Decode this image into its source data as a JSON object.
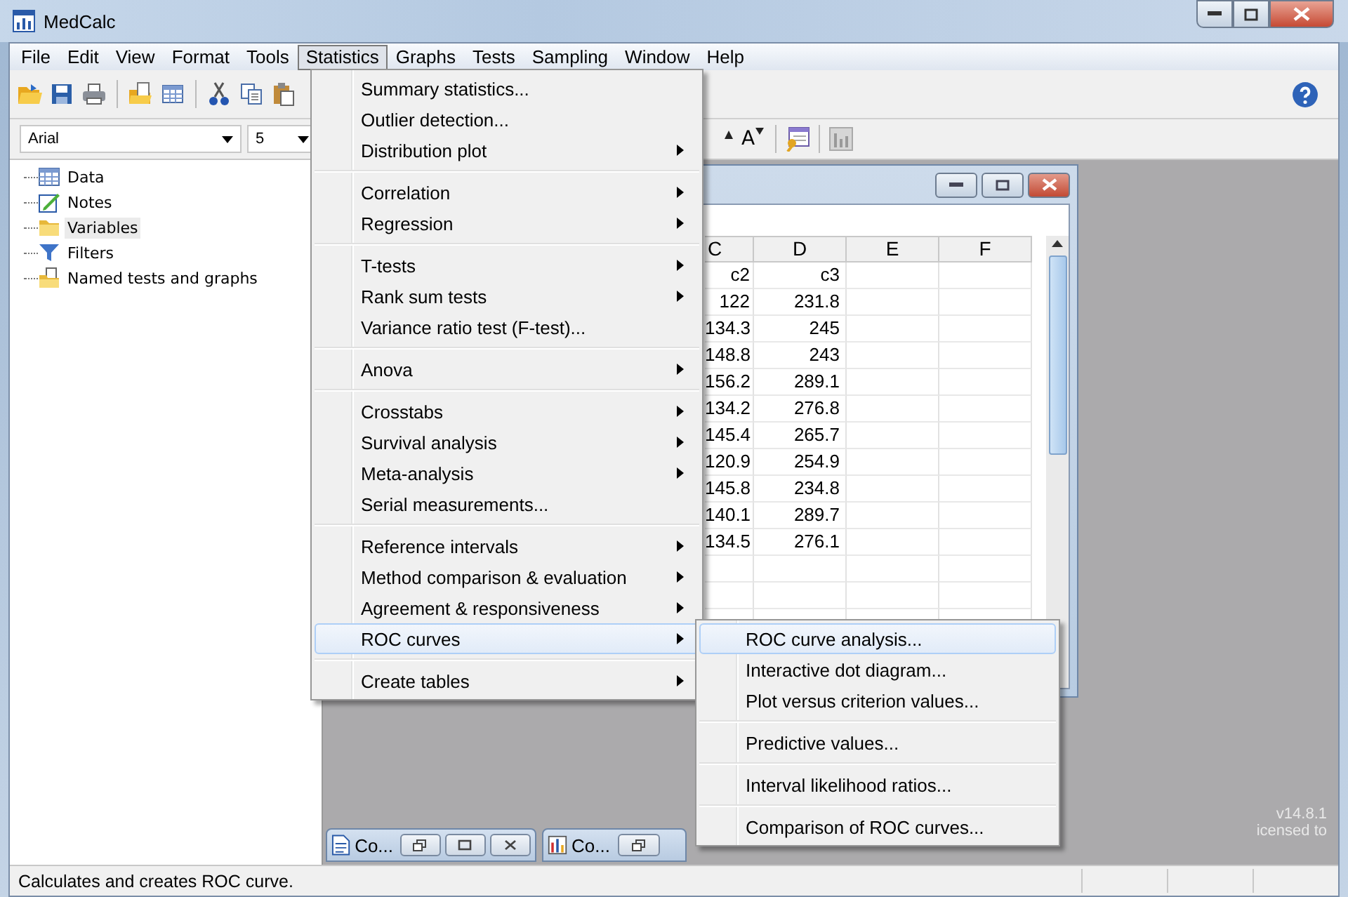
{
  "window": {
    "title": "MedCalc"
  },
  "menubar": [
    {
      "label": "File",
      "selected": false
    },
    {
      "label": "Edit",
      "selected": false
    },
    {
      "label": "View",
      "selected": false
    },
    {
      "label": "Format",
      "selected": false
    },
    {
      "label": "Tools",
      "selected": false
    },
    {
      "label": "Statistics",
      "selected": true
    },
    {
      "label": "Graphs",
      "selected": false
    },
    {
      "label": "Tests",
      "selected": false
    },
    {
      "label": "Sampling",
      "selected": false
    },
    {
      "label": "Window",
      "selected": false
    },
    {
      "label": "Help",
      "selected": false
    }
  ],
  "format_toolbar": {
    "font": "Arial",
    "size": "5",
    "shrink_font": "A"
  },
  "tree": {
    "items": [
      {
        "label": "Data",
        "selected": false
      },
      {
        "label": "Notes",
        "selected": false
      },
      {
        "label": "Variables",
        "selected": true
      },
      {
        "label": "Filters",
        "selected": false
      },
      {
        "label": "Named tests and graphs",
        "selected": false
      }
    ]
  },
  "spreadsheet": {
    "columns": [
      "C",
      "D",
      "E",
      "F"
    ],
    "rows": [
      [
        "c2",
        "c3",
        "",
        ""
      ],
      [
        "122",
        "231.8",
        "",
        ""
      ],
      [
        "134.3",
        "245",
        "",
        ""
      ],
      [
        "148.8",
        "243",
        "",
        ""
      ],
      [
        "156.2",
        "289.1",
        "",
        ""
      ],
      [
        "134.2",
        "276.8",
        "",
        ""
      ],
      [
        "145.4",
        "265.7",
        "",
        ""
      ],
      [
        "120.9",
        "254.9",
        "",
        ""
      ],
      [
        "145.8",
        "234.8",
        "",
        ""
      ],
      [
        "140.1",
        "289.7",
        "",
        ""
      ],
      [
        "134.5",
        "276.1",
        "",
        ""
      ]
    ]
  },
  "minimized_windows": [
    {
      "title": "Co..."
    },
    {
      "title": "Co..."
    }
  ],
  "version_text": [
    "v14.8.1",
    "icensed to"
  ],
  "statistics_menu": {
    "sections": [
      [
        {
          "label": "Summary statistics...",
          "submenu": false,
          "selected": false
        },
        {
          "label": "Outlier detection...",
          "submenu": false,
          "selected": false
        },
        {
          "label": "Distribution plot",
          "submenu": true,
          "selected": false
        }
      ],
      [
        {
          "label": "Correlation",
          "submenu": true,
          "selected": false
        },
        {
          "label": "Regression",
          "submenu": true,
          "selected": false
        }
      ],
      [
        {
          "label": "T-tests",
          "submenu": true,
          "selected": false
        },
        {
          "label": "Rank sum tests",
          "submenu": true,
          "selected": false
        },
        {
          "label": "Variance ratio test (F-test)...",
          "submenu": false,
          "selected": false
        }
      ],
      [
        {
          "label": "Anova",
          "submenu": true,
          "selected": false
        }
      ],
      [
        {
          "label": "Crosstabs",
          "submenu": true,
          "selected": false
        },
        {
          "label": "Survival analysis",
          "submenu": true,
          "selected": false
        },
        {
          "label": "Meta-analysis",
          "submenu": true,
          "selected": false
        },
        {
          "label": "Serial measurements...",
          "submenu": false,
          "selected": false
        }
      ],
      [
        {
          "label": "Reference intervals",
          "submenu": true,
          "selected": false
        },
        {
          "label": "Method comparison & evaluation",
          "submenu": true,
          "selected": false
        },
        {
          "label": "Agreement & responsiveness",
          "submenu": true,
          "selected": false
        },
        {
          "label": "ROC curves",
          "submenu": true,
          "selected": true
        }
      ],
      [
        {
          "label": "Create tables",
          "submenu": true,
          "selected": false
        }
      ]
    ]
  },
  "roc_submenu": {
    "sections": [
      [
        {
          "label": "ROC curve analysis...",
          "submenu": false,
          "selected": true
        },
        {
          "label": "Interactive dot diagram...",
          "submenu": false,
          "selected": false
        },
        {
          "label": "Plot versus criterion values...",
          "submenu": false,
          "selected": false
        }
      ],
      [
        {
          "label": "Predictive values...",
          "submenu": false,
          "selected": false
        }
      ],
      [
        {
          "label": "Interval likelihood ratios...",
          "submenu": false,
          "selected": false
        }
      ],
      [
        {
          "label": "Comparison of ROC curves...",
          "submenu": false,
          "selected": false
        }
      ]
    ]
  },
  "status_bar": "Calculates and creates ROC curve."
}
